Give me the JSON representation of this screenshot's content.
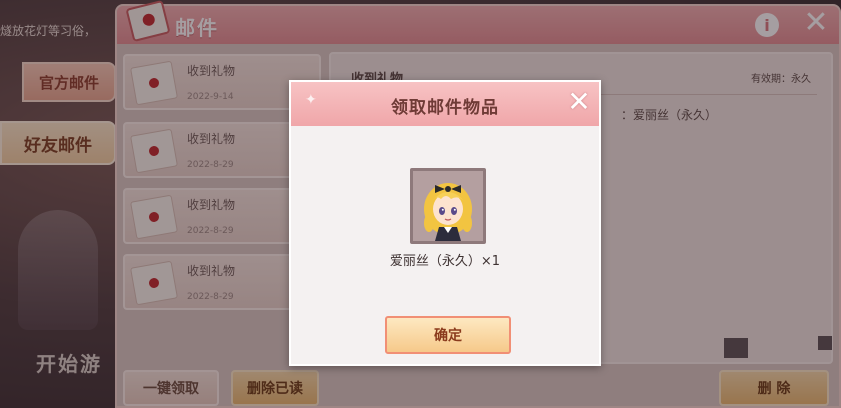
{
  "background": {
    "banner_text": "燧放花灯等习俗，",
    "start_text": "开始游"
  },
  "side_tabs": {
    "official_label": "官方邮件",
    "friend_label": "好友邮件"
  },
  "mail_window": {
    "title": "邮件",
    "info_label": "i",
    "close_label": "✕",
    "mails": [
      {
        "subject": "收到礼物",
        "date": "2022-9-14"
      },
      {
        "subject": "收到礼物",
        "date": "2022-8-29"
      },
      {
        "subject": "收到礼物",
        "date": "2022-8-29"
      },
      {
        "subject": "收到礼物",
        "date": "2022-8-29"
      }
    ],
    "detail": {
      "subject": "收到礼物",
      "validity": "有效期：永久",
      "body_fragment": "：爱丽丝（永久）"
    },
    "buttons": {
      "claim_all": "一键领取",
      "delete_read": "删除已读",
      "delete": "删 除"
    }
  },
  "dialog": {
    "title": "领取邮件物品",
    "close_label": "✕",
    "item_name": "爱丽丝（永久）×1",
    "confirm_label": "确定"
  },
  "colors": {
    "header_pink": "#e48d92",
    "dialog_header": "#f0a6a9",
    "confirm_border": "#f18f75",
    "button_gold": "#eab96f"
  }
}
